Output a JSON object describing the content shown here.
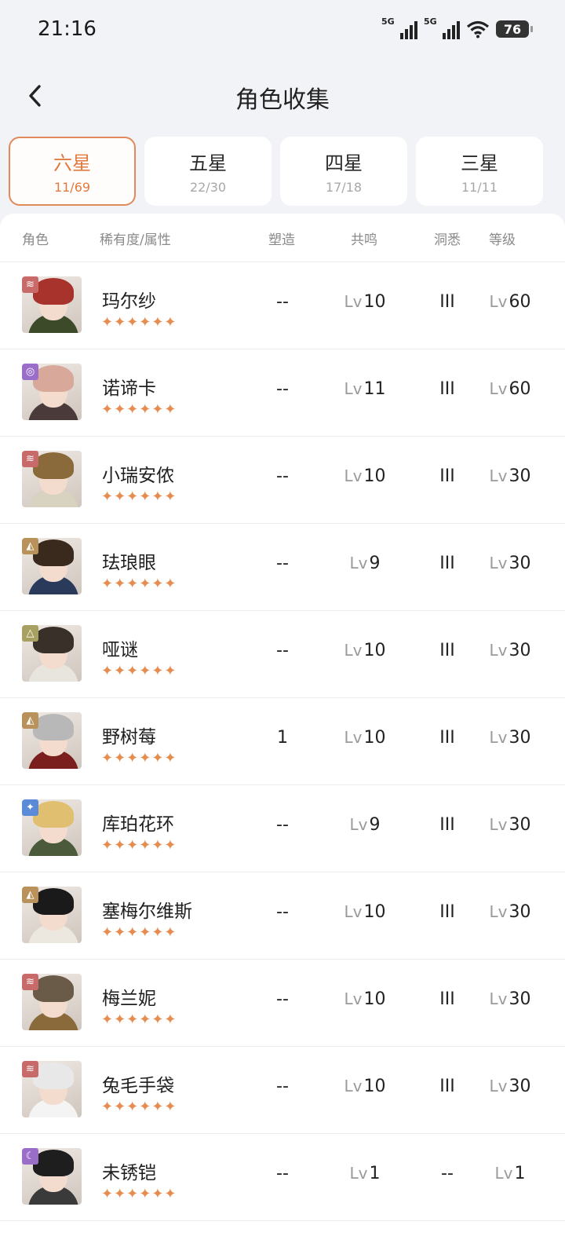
{
  "status": {
    "time": "21:16",
    "net1": "5G",
    "net2": "5G",
    "battery": "76"
  },
  "header": {
    "title": "角色收集"
  },
  "tabs": [
    {
      "label": "六星",
      "count": "11/69",
      "active": true
    },
    {
      "label": "五星",
      "count": "22/30",
      "active": false
    },
    {
      "label": "四星",
      "count": "17/18",
      "active": false
    },
    {
      "label": "三星",
      "count": "11/11",
      "active": false
    }
  ],
  "table": {
    "headers": {
      "character": "角色",
      "rarity": "稀有度/属性",
      "shaping": "塑造",
      "resonance": "共鸣",
      "insight": "洞悉",
      "level": "等级"
    },
    "level_prefix": "Lv",
    "stars": "✦✦✦✦✦✦",
    "rows": [
      {
        "name": "玛尔纱",
        "shaping": "--",
        "resonance": "10",
        "insight": "III",
        "level": "60",
        "attr_icon": "beast-claw-icon",
        "attr_color": "#c86a6a",
        "hair": "#a8322c",
        "body": "#3d4a2a"
      },
      {
        "name": "诺谛卡",
        "shaping": "--",
        "resonance": "11",
        "insight": "III",
        "level": "60",
        "attr_icon": "spiral-icon",
        "attr_color": "#9a6ec8",
        "hair": "#d8a99a",
        "body": "#4a3a3a"
      },
      {
        "name": "小瑞安侬",
        "shaping": "--",
        "resonance": "10",
        "insight": "III",
        "level": "30",
        "attr_icon": "beast-claw-icon",
        "attr_color": "#c86a6a",
        "hair": "#8a6a3a",
        "body": "#d8d2c0"
      },
      {
        "name": "珐琅眼",
        "shaping": "--",
        "resonance": "9",
        "insight": "III",
        "level": "30",
        "attr_icon": "rock-icon",
        "attr_color": "#b8925a",
        "hair": "#3a2a1e",
        "body": "#2a3a5a"
      },
      {
        "name": "哑谜",
        "shaping": "--",
        "resonance": "10",
        "insight": "III",
        "level": "30",
        "attr_icon": "triangle-sigil-icon",
        "attr_color": "#a8a060",
        "hair": "#3a302a",
        "body": "#e8e4de"
      },
      {
        "name": "野树莓",
        "shaping": "1",
        "resonance": "10",
        "insight": "III",
        "level": "30",
        "attr_icon": "rock-icon",
        "attr_color": "#b8925a",
        "hair": "#b8b8b8",
        "body": "#7a1e1e"
      },
      {
        "name": "库珀花环",
        "shaping": "--",
        "resonance": "9",
        "insight": "III",
        "level": "30",
        "attr_icon": "star-icon",
        "attr_color": "#5a8ad8",
        "hair": "#e0c070",
        "body": "#4a5a3a"
      },
      {
        "name": "塞梅尔维斯",
        "shaping": "--",
        "resonance": "10",
        "insight": "III",
        "level": "30",
        "attr_icon": "rock-icon",
        "attr_color": "#b8925a",
        "hair": "#1a1a1a",
        "body": "#ece8e0"
      },
      {
        "name": "梅兰妮",
        "shaping": "--",
        "resonance": "10",
        "insight": "III",
        "level": "30",
        "attr_icon": "beast-claw-icon",
        "attr_color": "#c86a6a",
        "hair": "#6a5a48",
        "body": "#8a6a3a"
      },
      {
        "name": "兔毛手袋",
        "shaping": "--",
        "resonance": "10",
        "insight": "III",
        "level": "30",
        "attr_icon": "beast-claw-icon",
        "attr_color": "#c86a6a",
        "hair": "#e8e8e8",
        "body": "#f4f4f4"
      },
      {
        "name": "未锈铠",
        "shaping": "--",
        "resonance": "1",
        "insight": "--",
        "level": "1",
        "attr_icon": "moon-icon",
        "attr_color": "#9a6ec8",
        "hair": "#1e1e1e",
        "body": "#3a3a3a"
      }
    ]
  },
  "colors": {
    "accent": "#e07a3f",
    "star": "#e58c4e"
  }
}
